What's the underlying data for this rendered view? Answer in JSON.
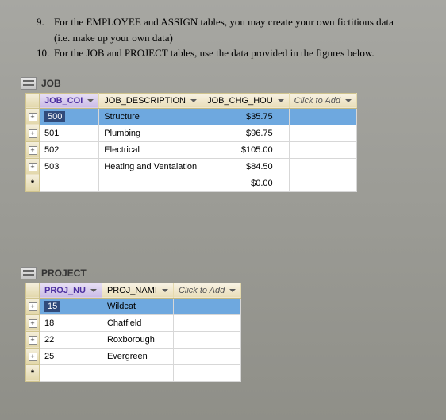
{
  "instructions": {
    "item9_num": "9.",
    "item9_text": "For the EMPLOYEE and ASSIGN tables, you may create your own fictitious data",
    "item9_sub": "(i.e. make up your own data)",
    "item10_num": "10.",
    "item10_text": "For the JOB and PROJECT tables, use the data provided in the figures below."
  },
  "job": {
    "title": "JOB",
    "headers": {
      "c1": "JOB_COI",
      "c2": "JOB_DESCRIPTION",
      "c3": "JOB_CHG_HOU",
      "add": "Click to Add"
    },
    "rows": [
      {
        "id": "500",
        "desc": "Structure",
        "chg": "$35.75",
        "selected": true
      },
      {
        "id": "501",
        "desc": "Plumbing",
        "chg": "$96.75"
      },
      {
        "id": "502",
        "desc": "Electrical",
        "chg": "$105.00"
      },
      {
        "id": "503",
        "desc": "Heating and Ventalation",
        "chg": "$84.50"
      }
    ],
    "newrow_chg": "$0.00"
  },
  "project": {
    "title": "PROJECT",
    "headers": {
      "c1": "PROJ_NU",
      "c2": "PROJ_NAMI",
      "add": "Click to Add"
    },
    "rows": [
      {
        "id": "15",
        "name": "Wildcat",
        "selected": true
      },
      {
        "id": "18",
        "name": "Chatfield"
      },
      {
        "id": "22",
        "name": "Roxborough"
      },
      {
        "id": "25",
        "name": "Evergreen"
      }
    ]
  }
}
